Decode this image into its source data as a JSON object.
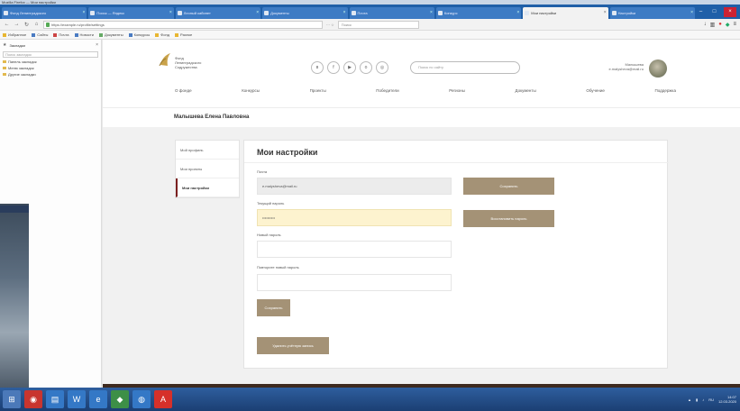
{
  "window": {
    "title": "Mozilla Firefox — Мои настройки"
  },
  "browser": {
    "tabs": [
      {
        "label": "Фонд Ленинградского"
      },
      {
        "label": "Поиск — Яндекс"
      },
      {
        "label": "Личный кабинет"
      },
      {
        "label": "Документы"
      },
      {
        "label": "Почта"
      },
      {
        "label": "Конкурс"
      },
      {
        "label": "Мои настройки",
        "active": true
      },
      {
        "label": "Настройки"
      }
    ],
    "url": "https://example.ru/profile/settings",
    "search_placeholder": "Поиск",
    "bookmarks": [
      "Избранное",
      "Сайты",
      "Почта",
      "Новости",
      "Документы",
      "Конкурсы",
      "Фонд",
      "Разное"
    ],
    "sidepanel": {
      "title": "Закладки",
      "search_placeholder": "Поиск закладок",
      "items": [
        "Панель закладок",
        "Меню закладок",
        "Другие закладки"
      ]
    }
  },
  "site": {
    "logo_lines": [
      "Фонд",
      "Ленинградского",
      "Содружества"
    ],
    "social_icons": [
      "vk-icon",
      "facebook-icon",
      "youtube-icon",
      "ok-icon",
      "instagram-icon"
    ],
    "search_placeholder": "Поиск по сайту",
    "user": {
      "line1": "Малышева",
      "line2": "e.malysheva@mail.ru"
    },
    "nav": [
      "О фонде",
      "Конкурсы",
      "Проекты",
      "Победители",
      "Регионы",
      "Документы",
      "Обучение",
      "Поддержка"
    ],
    "person_name": "Малышева Елена Павловна",
    "profile_menu": [
      {
        "label": "Мой профиль",
        "active": false
      },
      {
        "label": "Мои проекты",
        "active": false
      },
      {
        "label": "Мои настройки",
        "active": true
      }
    ],
    "settings": {
      "title": "Мои настройки",
      "email_label": "Почта",
      "email_value": "e.malysheva@mail.ru",
      "save_email_button": "Сохранить",
      "current_password_label": "Текущий пароль",
      "current_password_value": "••••••••••",
      "reset_password_button": "Восстановить пароль",
      "new_password_label": "Новый пароль",
      "confirm_password_label": "Повторите новый пароль",
      "save_button": "Сохранить",
      "delete_button": "Удалить учётную запись"
    }
  },
  "taskbar": {
    "clock_time": "14:07",
    "clock_date": "12.03.2020",
    "lang": "RU"
  },
  "colors": {
    "accent_button": "#a49276",
    "autofill": "#fdf3cf",
    "active_menu_border": "#7a1f1f"
  }
}
